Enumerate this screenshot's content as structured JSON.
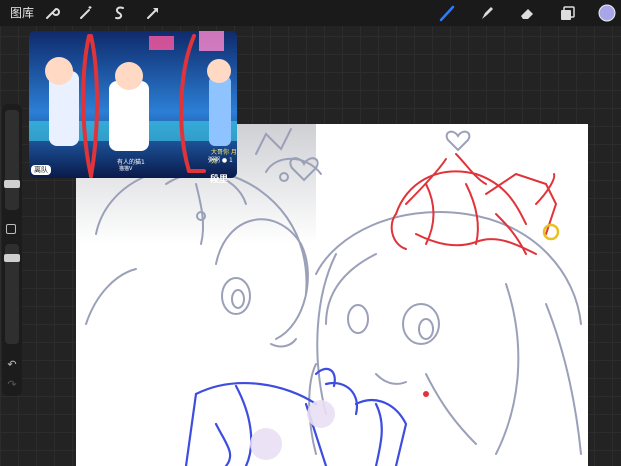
{
  "topbar": {
    "gallery_label": "图库",
    "left_tools": [
      "wrench-icon",
      "magic-wand-icon",
      "selection-icon",
      "transform-icon"
    ],
    "right_tools": [
      "brush-icon",
      "smudge-icon",
      "eraser-icon",
      "layers-icon",
      "color-swatch"
    ],
    "active_tool_color": "#2e7bff",
    "swatch_color": "#a8a6e8"
  },
  "sidebar": {
    "undo_icon": "undo-icon",
    "redo_icon": "redo-icon",
    "modify_icon": "modify-square-icon"
  },
  "reference": {
    "caption": "离队",
    "player_label": "有人的猫1",
    "player_sub": "猫猫V",
    "right_label_1": "大哥你 月亮",
    "right_label_2": "粥粥 ● 1",
    "overlay_text": "段里"
  },
  "colors": {
    "sketch_gray": "#9aa0b8",
    "sketch_blue": "#3d4de0",
    "sketch_red": "#e0343a",
    "accent_yellow": "#e8c020"
  }
}
